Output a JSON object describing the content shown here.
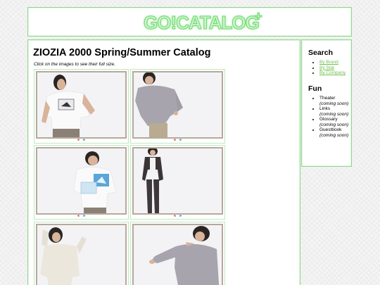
{
  "header": {
    "logo_text": "GO!CATALOG",
    "logo_plus": "+"
  },
  "main": {
    "title": "ZIOZIA 2000 Spring/Summer Catalog",
    "subtitle": "Click on the images to see their full size.",
    "thumbnails": [
      {
        "description_icon": "model-white-tshirt-photo"
      },
      {
        "description_icon": "model-grey-sweater-photo"
      },
      {
        "description_icon": "model-white-tshirt-book-photo"
      },
      {
        "description_icon": "model-dark-suit-photo"
      },
      {
        "description_icon": "model-cream-sweater-photo"
      },
      {
        "description_icon": "model-grey-sweater-crouch-photo"
      }
    ],
    "nav_prev": "◄",
    "nav_next": "►"
  },
  "sidebar": {
    "search_heading": "Search",
    "search_links": [
      "By Brand",
      "By Stat",
      "By Company"
    ],
    "fun_heading": "Fun",
    "fun_items": [
      {
        "label": "Theater",
        "note": "(coming soon)"
      },
      {
        "label": "Links",
        "note": "(coming soon)"
      },
      {
        "label": "Glossary",
        "note": "(coming soon)"
      },
      {
        "label": "Guestbook",
        "note": "(coming soon)"
      }
    ]
  },
  "colors": {
    "border": "#8fd88f",
    "link": "#6fbf4f",
    "logo": "#c8f5c8"
  }
}
